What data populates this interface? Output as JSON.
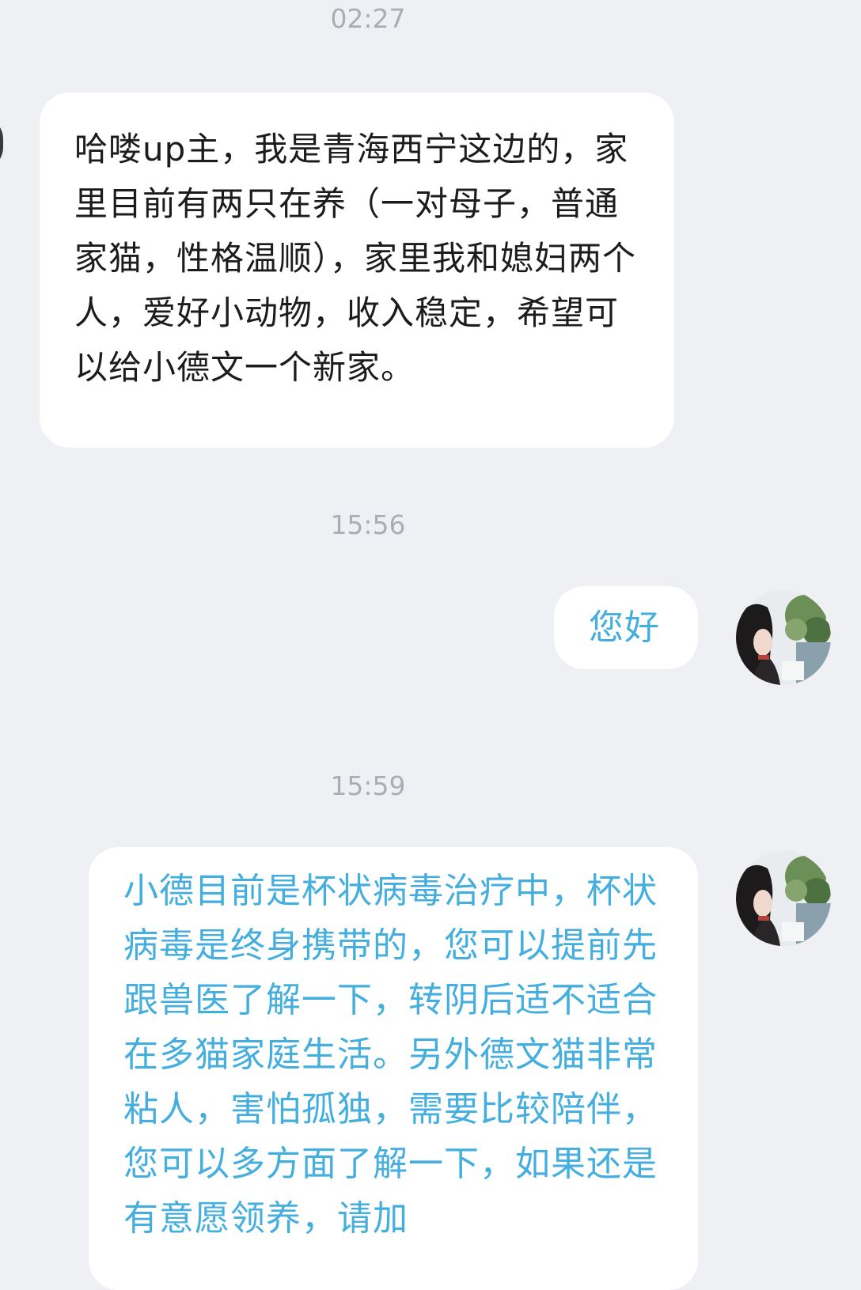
{
  "chat": {
    "timestamps": [
      "02:27",
      "15:56",
      "15:59"
    ],
    "messages": [
      {
        "sender": "other",
        "text": "哈喽up主，我是青海西宁这边的，家里目前有两只在养（一对母子，普通家猫，性格温顺），家里我和媳妇两个人，爱好小动物，收入稳定，希望可以给小德文一个新家。"
      },
      {
        "sender": "self",
        "text": "您好"
      },
      {
        "sender": "self",
        "text": "小德目前是杯状病毒治疗中，杯状病毒是终身携带的，您可以提前先跟兽医了解一下，转阴后适不适合在多猫家庭生活。另外德文猫非常粘人，害怕孤独，需要比较陪伴，您可以多方面了解一下，如果还是有意愿领养，请加"
      }
    ]
  },
  "colors": {
    "background": "#eff0f4",
    "incoming_text": "#1c1c1e",
    "outgoing_text": "#44aede",
    "timestamp": "#a9aeb6"
  }
}
